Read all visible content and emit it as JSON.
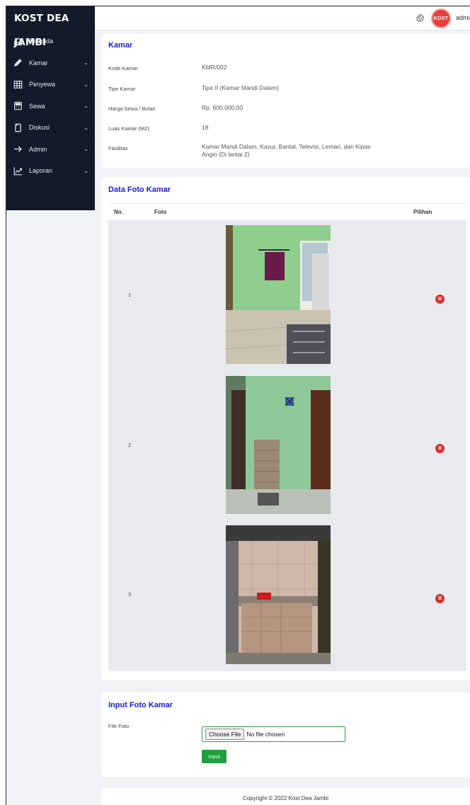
{
  "brand": "KOST DEA JAMBI",
  "sidebar": {
    "items": [
      {
        "label": "Beranda",
        "icon": "home-icon",
        "has_submenu": false
      },
      {
        "label": "Kamar",
        "icon": "pencil-icon",
        "has_submenu": true
      },
      {
        "label": "Penyewa",
        "icon": "table-icon",
        "has_submenu": true
      },
      {
        "label": "Sewa",
        "icon": "calculator-icon",
        "has_submenu": true
      },
      {
        "label": "Diskusi",
        "icon": "copy-icon",
        "has_submenu": true
      },
      {
        "label": "Admin",
        "icon": "arrow-right-icon",
        "has_submenu": true
      },
      {
        "label": "Laporan",
        "icon": "trend-chart-icon",
        "has_submenu": true
      }
    ]
  },
  "topbar": {
    "user_name": "admin",
    "avatar_text": "KOST"
  },
  "kamar": {
    "title": "Kamar",
    "fields": [
      {
        "label": "Kode Kamar",
        "value": "KMR/002"
      },
      {
        "label": "Tipe Kamar",
        "value": "Tipe II (Kamar Mandi Dalam)"
      },
      {
        "label": "Harga Sewa / Bulan",
        "value": "Rp. 600.000,00"
      },
      {
        "label": "Luas Kamar (M2)",
        "value": "18"
      },
      {
        "label": "Fasilitas",
        "value": "Kamar Mandi Dalam, Kasur, Bantal, Televisi, Lemari, dan Kipas Angin (Di lantai 2)"
      }
    ]
  },
  "foto": {
    "title": "Data Foto Kamar",
    "headers": {
      "no": "No.",
      "foto": "Foto",
      "pilihan": "Pilihan"
    },
    "rows": [
      {
        "no": "1"
      },
      {
        "no": "2"
      },
      {
        "no": "3"
      }
    ]
  },
  "input_foto": {
    "title": "Input Foto Kamar",
    "file_label": "File Foto",
    "choose_label": "Choose File",
    "no_file_text": "No file chosen",
    "submit_label": "Input"
  },
  "footer": {
    "text": "Copyright © 2022 Kost Dea Jambi"
  },
  "colors": {
    "sidebar_bg": "#131b2b",
    "title_blue": "#1a1ad8",
    "button_green": "#1f9e3f",
    "delete_red": "#d7322e"
  }
}
